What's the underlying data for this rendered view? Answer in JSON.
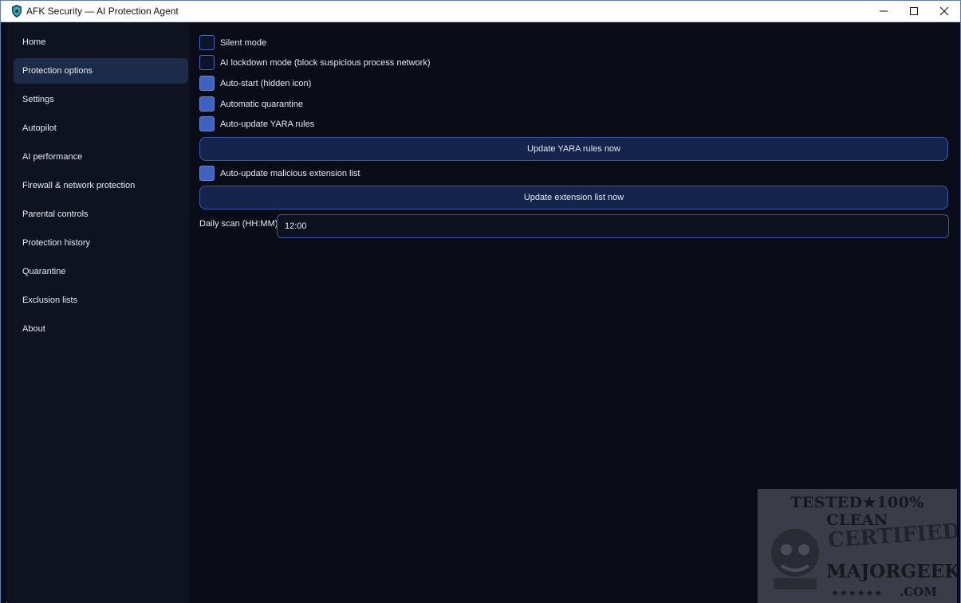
{
  "window": {
    "title": "AFK Security — AI Protection Agent",
    "accent": "#3e62c2",
    "background": "#0a0d18",
    "controls": {
      "minimize": "minimize-icon",
      "maximize": "maximize-icon",
      "close": "close-icon"
    }
  },
  "sidebar": {
    "items": [
      {
        "label": "Home",
        "active": false
      },
      {
        "label": "Protection options",
        "active": true
      },
      {
        "label": "Settings",
        "active": false
      },
      {
        "label": "Autopilot",
        "active": false
      },
      {
        "label": "AI performance",
        "active": false
      },
      {
        "label": "Firewall & network protection",
        "active": false
      },
      {
        "label": "Parental controls",
        "active": false
      },
      {
        "label": "Protection history",
        "active": false
      },
      {
        "label": "Quarantine",
        "active": false
      },
      {
        "label": "Exclusion lists",
        "active": false
      },
      {
        "label": "About",
        "active": false
      }
    ]
  },
  "options": {
    "silent_mode": {
      "label": "Silent mode",
      "checked": false
    },
    "ai_lockdown": {
      "label": "AI lockdown mode (block suspicious process network)",
      "checked": false
    },
    "auto_start": {
      "label": "Auto-start (hidden icon)",
      "checked": true
    },
    "auto_quarantine": {
      "label": "Automatic quarantine",
      "checked": true
    },
    "auto_update_yara": {
      "label": "Auto-update YARA rules",
      "checked": true
    },
    "update_yara_button": "Update YARA rules now",
    "auto_update_extensions": {
      "label": "Auto-update malicious extension list",
      "checked": true
    },
    "update_extensions_button": "Update extension list now",
    "daily_scan": {
      "label": "Daily scan (HH:MM)",
      "value": "12:00"
    }
  },
  "watermark": {
    "top": "TESTED★100% CLEAN",
    "certified": "CERTIFIED",
    "brand": "MAJORGEEKS",
    "site": ".COM",
    "stars": "★★★★★★"
  }
}
